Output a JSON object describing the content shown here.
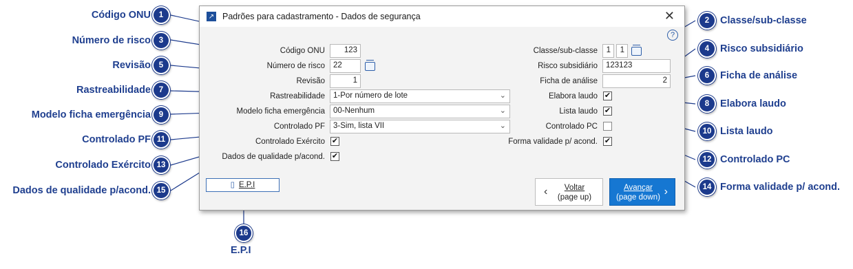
{
  "dialog": {
    "title": "Padrões para cadastramento - Dados de segurança",
    "close_glyph": "✕",
    "help_glyph": "?"
  },
  "fields": {
    "codigo_onu": {
      "label": "Código ONU",
      "value": "123"
    },
    "numero_risco": {
      "label": "Número de risco",
      "value": "22"
    },
    "revisao": {
      "label": "Revisão",
      "value": "1"
    },
    "rastreabilidade": {
      "label": "Rastreabilidade",
      "value": "1-Por número de lote"
    },
    "modelo_ficha": {
      "label": "Modelo ficha emergência",
      "value": "00-Nenhum"
    },
    "controlado_pf": {
      "label": "Controlado PF",
      "value": "3-Sim, lista VII"
    },
    "controlado_exercito": {
      "label": "Controlado Exército",
      "checked": true
    },
    "dados_qualidade": {
      "label": "Dados de qualidade p/acond.",
      "checked": true
    },
    "classe_subclasse": {
      "label": "Classe/sub-classe",
      "value_1": "1",
      "value_2": "1"
    },
    "risco_subsidiario": {
      "label": "Risco subsidiário",
      "value": "123123"
    },
    "ficha_analise": {
      "label": "Ficha de análise",
      "value": "2"
    },
    "elabora_laudo": {
      "label": "Elabora laudo",
      "checked": true
    },
    "lista_laudo": {
      "label": "Lista laudo",
      "checked": true
    },
    "controlado_pc": {
      "label": "Controlado PC",
      "checked": false
    },
    "forma_validade": {
      "label": "Forma validade p/ acond.",
      "checked": true
    }
  },
  "buttons": {
    "epi": "E.P.I",
    "back_line1": "Voltar",
    "back_line2": "(page up)",
    "next_line1": "Avançar",
    "next_line2": "(page down)"
  },
  "callouts": [
    {
      "num": "1",
      "label": "Código ONU"
    },
    {
      "num": "2",
      "label": "Classe/sub-classe"
    },
    {
      "num": "3",
      "label": "Número de risco"
    },
    {
      "num": "4",
      "label": "Risco subsidiário"
    },
    {
      "num": "5",
      "label": "Revisão"
    },
    {
      "num": "6",
      "label": "Ficha de análise"
    },
    {
      "num": "7",
      "label": "Rastreabilidade"
    },
    {
      "num": "8",
      "label": "Elabora laudo"
    },
    {
      "num": "9",
      "label": "Modelo ficha emergência"
    },
    {
      "num": "10",
      "label": "Lista laudo"
    },
    {
      "num": "11",
      "label": "Controlado PF"
    },
    {
      "num": "12",
      "label": "Controlado PC"
    },
    {
      "num": "13",
      "label": "Controlado Exército"
    },
    {
      "num": "14",
      "label": "Forma validade p/ acond."
    },
    {
      "num": "15",
      "label": "Dados de qualidade p/acond."
    },
    {
      "num": "16",
      "label": "E.P.I"
    }
  ],
  "colors": {
    "callout": "#1c3a8c",
    "accent": "#1677d2"
  }
}
